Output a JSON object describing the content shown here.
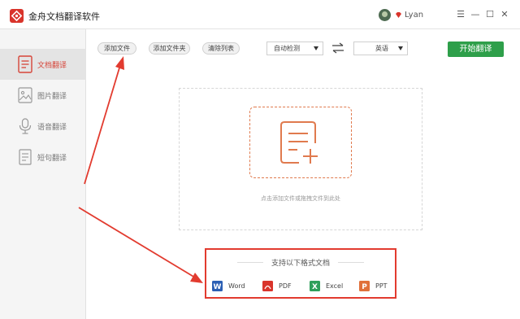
{
  "app": {
    "title": "金舟文档翻译软件",
    "user_name": "Lyan"
  },
  "window_controls": {
    "menu": "☰",
    "minimize": "—",
    "maximize": "☐",
    "close": "✕"
  },
  "sidebar": {
    "items": [
      {
        "label": "文档翻译",
        "icon": "document-icon",
        "active": true
      },
      {
        "label": "图片翻译",
        "icon": "image-icon",
        "active": false
      },
      {
        "label": "语音翻译",
        "icon": "microphone-icon",
        "active": false
      },
      {
        "label": "短句翻译",
        "icon": "note-icon",
        "active": false
      }
    ]
  },
  "toolbar": {
    "add_file": "添加文件",
    "add_folder": "添加文件夹",
    "clear_list": "清除列表",
    "source_lang": "自动检测",
    "target_lang": "英语",
    "start": "开始翻译"
  },
  "dropzone": {
    "hint": "点击添加文件或拖拽文件到此处"
  },
  "formats": {
    "title": "支持以下格式文档",
    "items": [
      {
        "label": "Word",
        "icon": "word-icon",
        "color": "#2b5fb4"
      },
      {
        "label": "PDF",
        "icon": "pdf-icon",
        "color": "#d9342b"
      },
      {
        "label": "Excel",
        "icon": "excel-icon",
        "color": "#2e9f5a"
      },
      {
        "label": "PPT",
        "icon": "ppt-icon",
        "color": "#e0703a"
      }
    ]
  },
  "colors": {
    "accent": "#d64438",
    "start_button": "#2e9f4a",
    "annotation": "#e23b2f",
    "dropzone_border": "#e07a4e"
  }
}
